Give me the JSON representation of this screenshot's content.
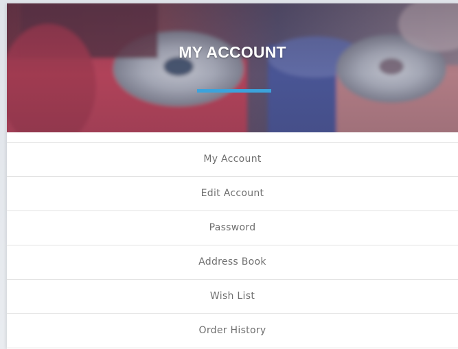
{
  "header": {
    "title": "MY ACCOUNT",
    "accent_color": "#3ba3dc"
  },
  "menu": {
    "items": [
      {
        "label": "My Account"
      },
      {
        "label": "Edit Account"
      },
      {
        "label": "Password"
      },
      {
        "label": "Address Book"
      },
      {
        "label": "Wish List"
      },
      {
        "label": "Order History"
      }
    ]
  }
}
